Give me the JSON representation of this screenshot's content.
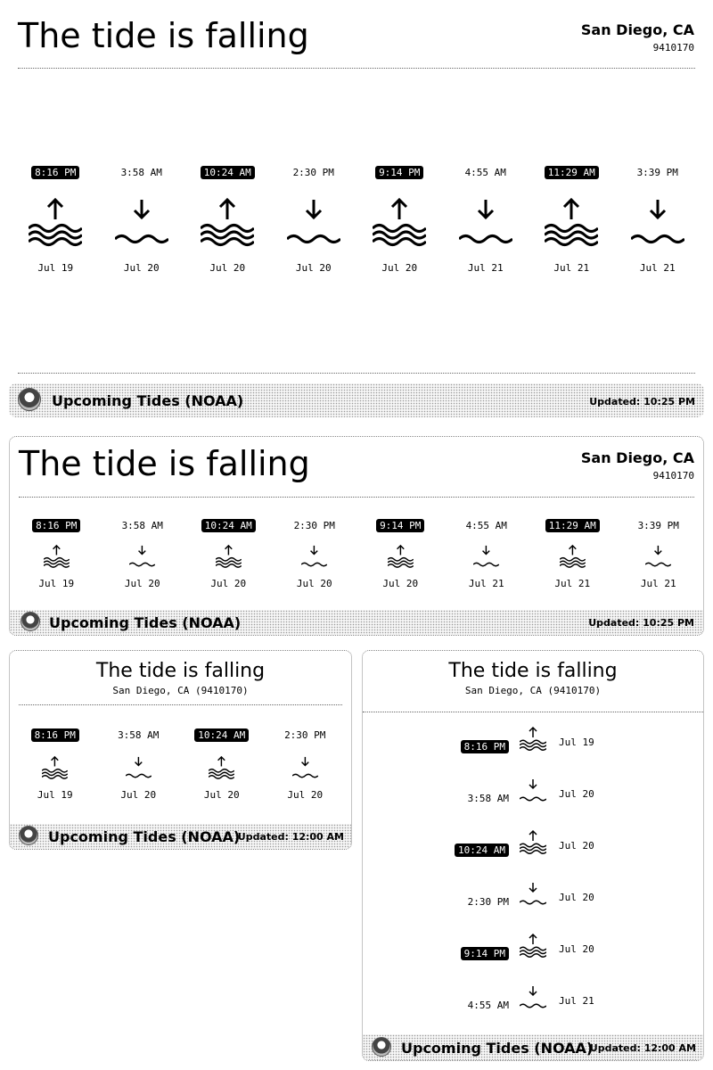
{
  "status_title": "The tide is falling",
  "location": "San Diego, CA",
  "station_id": "9410170",
  "location_inline": "San Diego, CA (9410170)",
  "footer_label": "Upcoming Tides (NOAA)",
  "widgets": {
    "large": {
      "updated": "Updated: 10:25 PM"
    },
    "wide": {
      "updated": "Updated: 10:25 PM"
    },
    "small": {
      "updated": "Updated: 12:00 AM"
    },
    "tall": {
      "updated": "Updated: 12:00 AM"
    }
  },
  "tides": [
    {
      "time": "8:16 PM",
      "type": "high",
      "date": "Jul 19"
    },
    {
      "time": "3:58 AM",
      "type": "low",
      "date": "Jul 20"
    },
    {
      "time": "10:24 AM",
      "type": "high",
      "date": "Jul 20"
    },
    {
      "time": "2:30 PM",
      "type": "low",
      "date": "Jul 20"
    },
    {
      "time": "9:14 PM",
      "type": "high",
      "date": "Jul 20"
    },
    {
      "time": "4:55 AM",
      "type": "low",
      "date": "Jul 21"
    },
    {
      "time": "11:29 AM",
      "type": "high",
      "date": "Jul 21"
    },
    {
      "time": "3:39 PM",
      "type": "low",
      "date": "Jul 21"
    }
  ],
  "icons": {
    "high": "rising-tide-icon",
    "low": "falling-tide-icon",
    "logo": "noaa-logo-icon"
  }
}
